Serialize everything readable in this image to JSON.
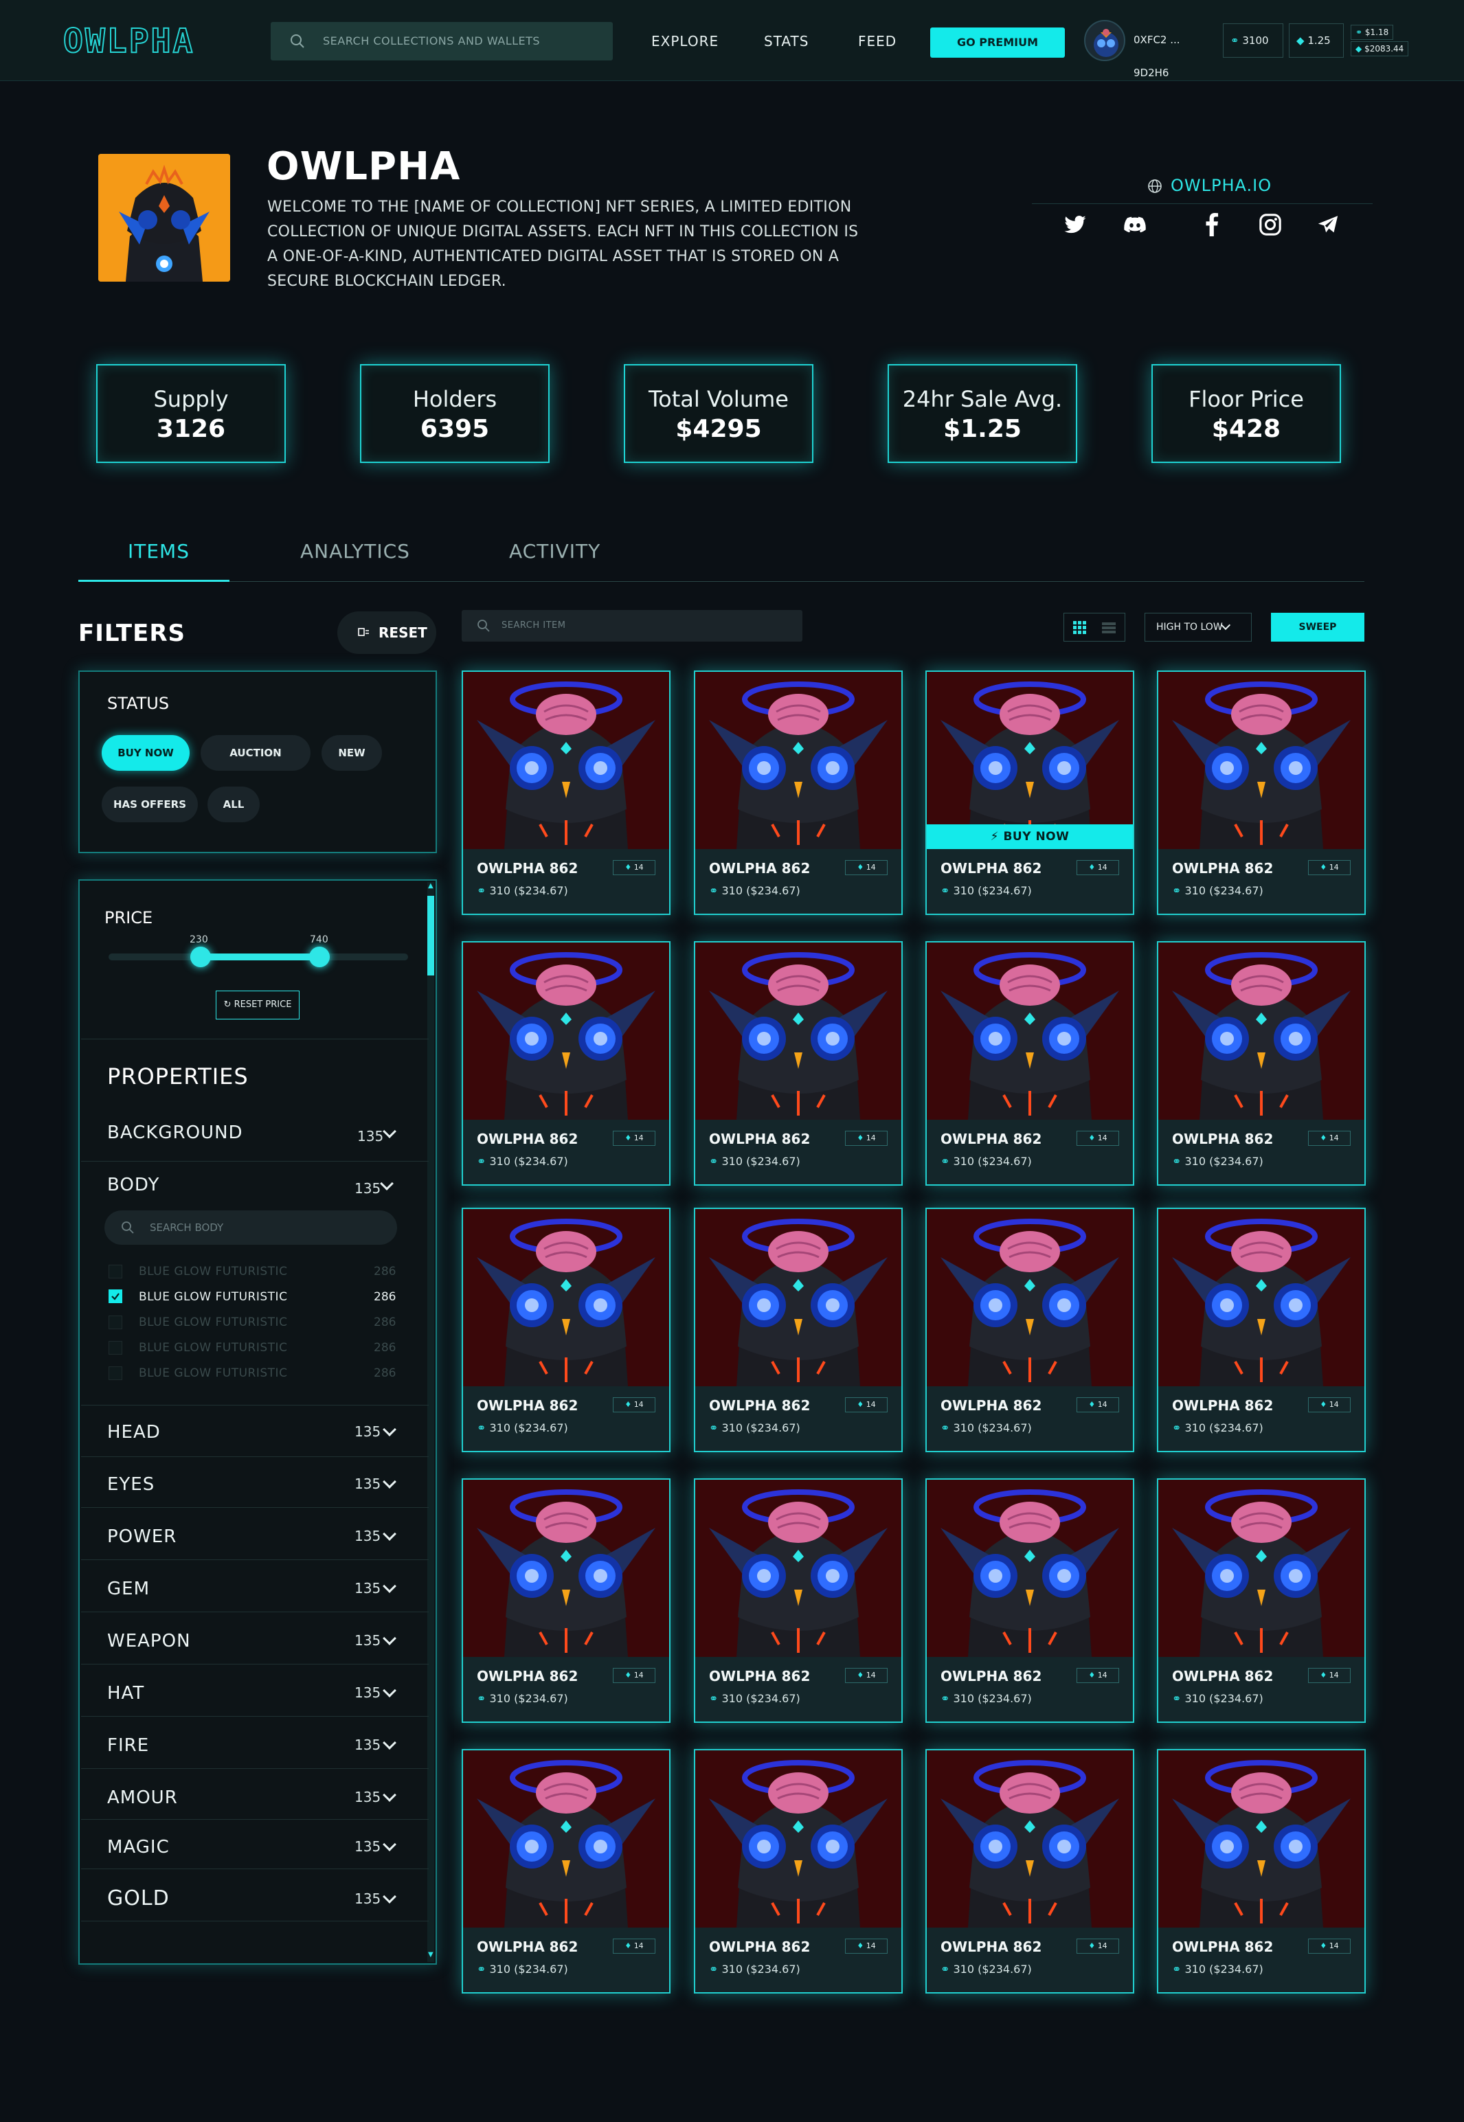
{
  "header": {
    "logo": "OWLPHA",
    "search_placeholder": "SEARCH COLLECTIONS AND WALLETS",
    "nav": [
      "EXPLORE",
      "STATS",
      "FEED"
    ],
    "premium_label": "GO PREMIUM",
    "wallet_address": "0XFC2 ... 9D2H6",
    "token_balance": "3100",
    "eth_balance": "1.25",
    "mini_top": "$1.18",
    "mini_bottom": "$2083.44"
  },
  "collection": {
    "title": "OWLPHA",
    "description": "WELCOME TO THE [NAME OF COLLECTION] NFT SERIES, A LIMITED EDITION COLLECTION OF UNIQUE DIGITAL ASSETS. EACH NFT IN THIS COLLECTION IS A ONE-OF-A-KIND, AUTHENTICATED DIGITAL ASSET THAT IS STORED ON A SECURE BLOCKCHAIN LEDGER.",
    "website": "OWLPHA.IO",
    "socials": [
      "twitter-icon",
      "discord-icon",
      "facebook-icon",
      "instagram-icon",
      "telegram-icon"
    ]
  },
  "stats": [
    {
      "label": "Supply",
      "value": "3126"
    },
    {
      "label": "Holders",
      "value": "6395"
    },
    {
      "label": "Total Volume",
      "value": "$4295"
    },
    {
      "label": "24hr Sale Avg.",
      "value": "$1.25"
    },
    {
      "label": "Floor Price",
      "value": "$428"
    }
  ],
  "tabs": [
    "ITEMS",
    "ANALYTICS",
    "ACTIVITY"
  ],
  "filters": {
    "title": "FILTERS",
    "reset_label": "RESET",
    "status_title": "STATUS",
    "status_options": [
      "BUY NOW",
      "AUCTION",
      "NEW",
      "HAS OFFERS",
      "ALL"
    ],
    "price_title": "PRICE",
    "price_min": "230",
    "price_max": "740",
    "reset_price_label": "RESET PRICE",
    "properties_title": "PROPERTIES",
    "body_search_placeholder": "SEARCH BODY",
    "body_options": [
      {
        "label": "BLUE GLOW FUTURISTIC",
        "count": "286",
        "checked": false
      },
      {
        "label": "BLUE GLOW FUTURISTIC",
        "count": "286",
        "checked": true
      },
      {
        "label": "BLUE GLOW FUTURISTIC",
        "count": "286",
        "checked": false
      },
      {
        "label": "BLUE GLOW FUTURISTIC",
        "count": "286",
        "checked": false
      },
      {
        "label": "BLUE GLOW FUTURISTIC",
        "count": "286",
        "checked": false
      }
    ],
    "properties": [
      {
        "name": "BACKGROUND",
        "count": "135"
      },
      {
        "name": "BODY",
        "count": "135"
      },
      {
        "name": "HEAD",
        "count": "135"
      },
      {
        "name": "EYES",
        "count": "135"
      },
      {
        "name": "POWER",
        "count": "135"
      },
      {
        "name": "GEM",
        "count": "135"
      },
      {
        "name": "WEAPON",
        "count": "135"
      },
      {
        "name": "HAT",
        "count": "135"
      },
      {
        "name": "FIRE",
        "count": "135"
      },
      {
        "name": "AMOUR",
        "count": "135"
      },
      {
        "name": "MAGIC",
        "count": "135"
      },
      {
        "name": "GOLD",
        "count": "135"
      }
    ]
  },
  "toolbar": {
    "search_placeholder": "SEARCH ITEM",
    "sort_label": "HIGH TO LOW",
    "sweep_label": "SWEEP"
  },
  "item": {
    "name": "OWLPHA 862",
    "rank": "14",
    "price": "310 ($234.67)",
    "buy_now_label": "BUY NOW"
  }
}
